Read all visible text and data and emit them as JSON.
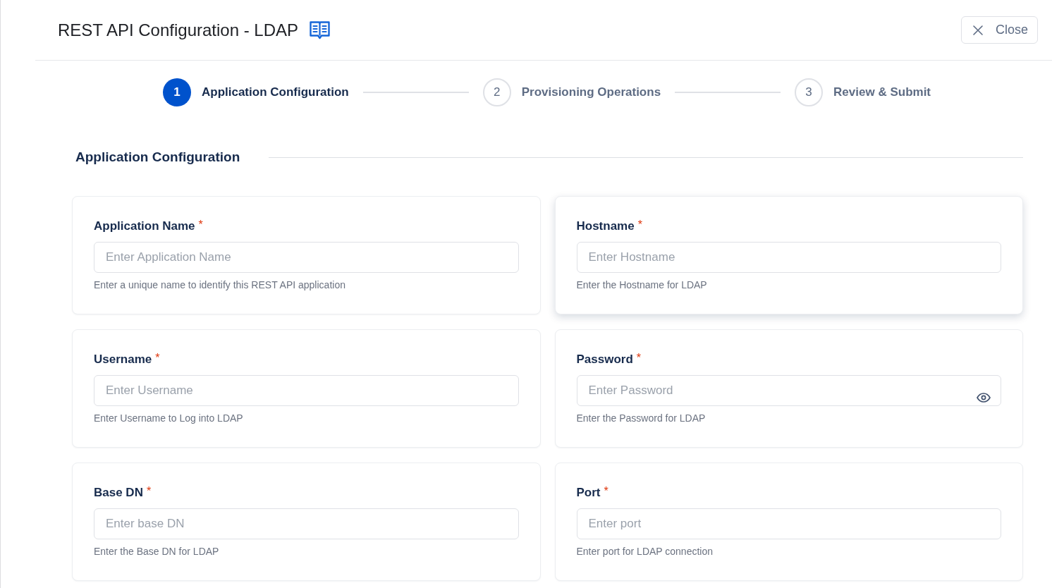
{
  "header": {
    "title": "REST API Configuration - LDAP",
    "close_button": {
      "label": "Close"
    }
  },
  "steps": [
    {
      "number": "1",
      "label": "Application Configuration",
      "selected": true
    },
    {
      "number": "2",
      "label": "Provisioning Operations",
      "selected": false
    },
    {
      "number": "3",
      "label": "Review & Submit",
      "selected": false
    }
  ],
  "section": {
    "title": "Application Configuration"
  },
  "fields": [
    {
      "kind": "text",
      "label": "Application Name",
      "required_mark": "*",
      "placeholder": "Enter Application Name",
      "help": "Enter a unique name to identify this REST API application",
      "hovered": false
    },
    {
      "kind": "text",
      "label": "Hostname",
      "required_mark": "*",
      "placeholder": "Enter Hostname",
      "help": "Enter the Hostname for LDAP",
      "hovered": true
    },
    {
      "kind": "text",
      "label": "Username",
      "required_mark": "*",
      "placeholder": "Enter Username",
      "help": "Enter Username to Log into LDAP",
      "hovered": false
    },
    {
      "kind": "password",
      "label": "Password",
      "required_mark": "*",
      "placeholder": "Enter Password",
      "help": "Enter the Password for LDAP",
      "hovered": false
    },
    {
      "kind": "text",
      "label": "Base DN",
      "required_mark": "*",
      "placeholder": "Enter base DN",
      "help": "Enter the Base DN for LDAP",
      "hovered": false
    },
    {
      "kind": "text",
      "label": "Port",
      "required_mark": "*",
      "placeholder": "Enter port",
      "help": "Enter port for LDAP connection",
      "hovered": false
    }
  ]
}
